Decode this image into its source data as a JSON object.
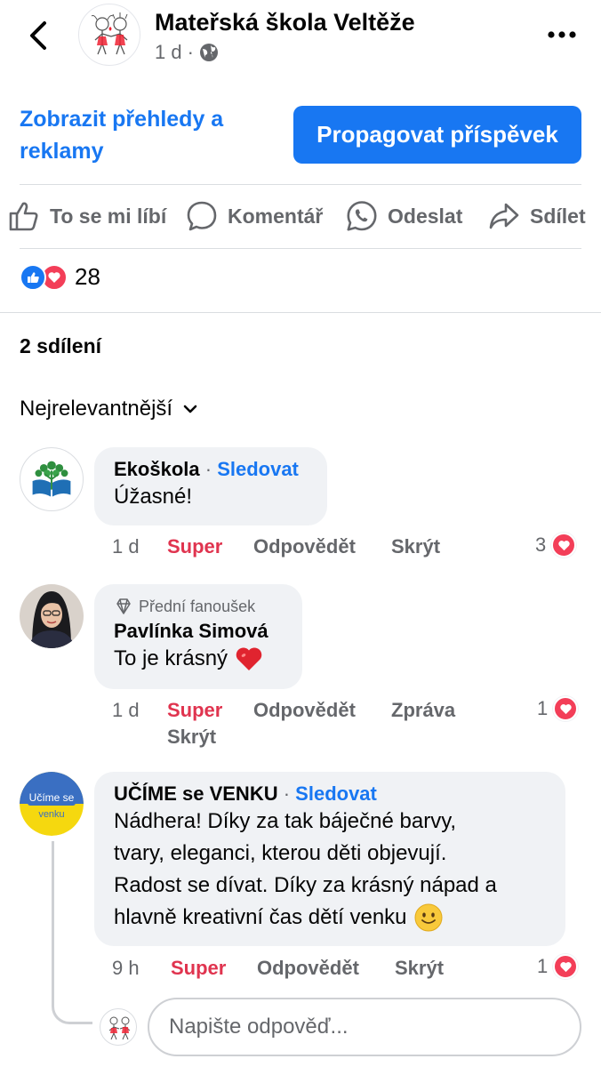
{
  "header": {
    "page_name": "Mateřská škola Veltěže",
    "time": "1 d",
    "separator": "·"
  },
  "promo": {
    "insights_label": "Zobrazit přehledy a reklamy",
    "promote_label": "Propagovat příspěvek"
  },
  "actions": {
    "like": "To se mi líbí",
    "comment": "Komentář",
    "send": "Odeslat",
    "share": "Sdílet"
  },
  "reactions": {
    "count": "28"
  },
  "shares": "2 sdílení",
  "sort": {
    "selected": "Nejrelevantnější"
  },
  "comments": [
    {
      "author": "Ekoškola",
      "dot": "·",
      "follow": "Sledovat",
      "text": "Úžasné!",
      "time": "1 d",
      "super": "Super",
      "reply": "Odpovědět",
      "hide": "Skrýt",
      "reaction_count": "3"
    },
    {
      "badge": "Přední fanoušek",
      "author": "Pavlínka Simová",
      "text": "To je krásný",
      "time": "1 d",
      "super": "Super",
      "reply": "Odpovědět",
      "message": "Zpráva",
      "hide": "Skrýt",
      "reaction_count": "1"
    },
    {
      "author": "UČÍME se VENKU",
      "dot": "·",
      "follow": "Sledovat",
      "avatar_text_1": "Učíme se",
      "avatar_text_2": "venku",
      "text_lines": [
        "Nádhera! Díky za tak báječné barvy,",
        "tvary, eleganci, kterou děti objevují.",
        "Radost se dívat. Díky za krásný nápad a",
        "hlavně kreativní čas dětí venku"
      ],
      "time": "9 h",
      "super": "Super",
      "reply": "Odpovědět",
      "hide": "Skrýt",
      "reaction_count": "1"
    }
  ],
  "reply_box": {
    "placeholder": "Napište odpověď..."
  },
  "colors": {
    "accent": "#1877f2",
    "love": "#f33e58",
    "super_text": "#e0344f",
    "secondary_text": "#65676b",
    "bubble": "#f0f2f5"
  }
}
